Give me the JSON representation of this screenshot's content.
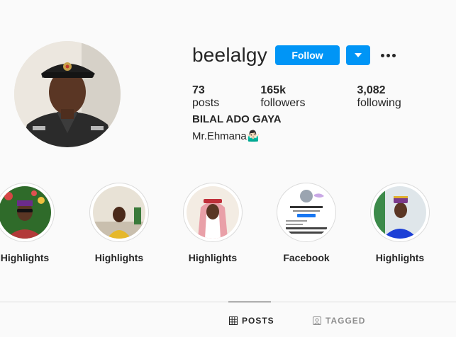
{
  "profile": {
    "username": "beelalgy",
    "follow_label": "Follow",
    "stats": {
      "posts_count": "73",
      "posts_label": "posts",
      "followers_count": "165k",
      "followers_label": "followers",
      "following_count": "3,082",
      "following_label": "following"
    },
    "full_name": "BILAL ADO GAYA ",
    "bio": "Mr.Ehmana🤷🏻‍♂"
  },
  "highlights": [
    {
      "label": "Highlights"
    },
    {
      "label": "Highlights"
    },
    {
      "label": "Highlights"
    },
    {
      "label": "Facebook"
    },
    {
      "label": "Highlights"
    }
  ],
  "tabs": [
    {
      "label": "POSTS",
      "icon": "grid-icon",
      "active": true
    },
    {
      "label": "TAGGED",
      "icon": "tagged-icon",
      "active": false
    }
  ],
  "colors": {
    "accent": "#0095f6",
    "text": "#262626",
    "muted": "#8e8e8e",
    "border": "#dbdbdb",
    "background": "#fafafa"
  }
}
